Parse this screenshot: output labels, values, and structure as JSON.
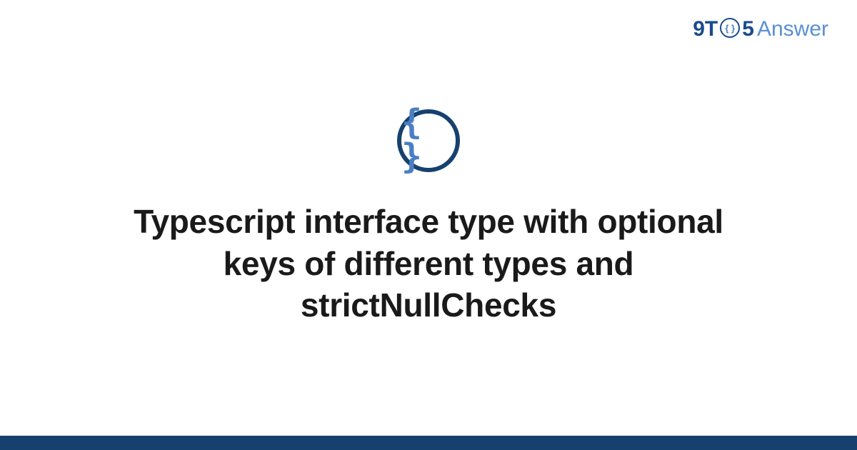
{
  "logo": {
    "part1": "9T",
    "circle_text": "{ }",
    "part2": "5",
    "part3": "Answer"
  },
  "icon": {
    "glyph": "{ }",
    "semantic": "code-braces"
  },
  "title": "Typescript interface type with optional keys of different types and strictNullChecks",
  "colors": {
    "brand_dark": "#16416f",
    "brand_light": "#4a7fc4"
  }
}
